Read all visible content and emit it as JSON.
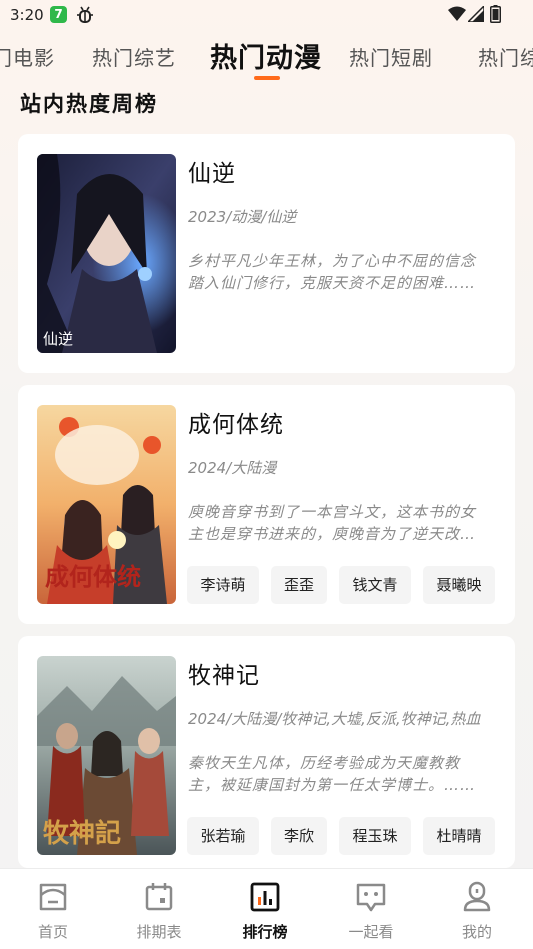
{
  "status_bar": {
    "time": "3:20",
    "app_badge": "7"
  },
  "tabs": [
    {
      "label": "门电影"
    },
    {
      "label": "热门综艺"
    },
    {
      "label": "热门动漫",
      "active": true
    },
    {
      "label": "热门短剧"
    },
    {
      "label": "热门综"
    }
  ],
  "section_title": "站内热度周榜",
  "items": [
    {
      "title": "仙逆",
      "meta": "2023/动漫/仙逆",
      "desc": "乡村平凡少年王林，为了心中不屈的信念踏入仙门修行，克服天资不足的困难……",
      "poster_text": "仙逆",
      "tags": []
    },
    {
      "title": "成何体统",
      "meta": "2024/大陆漫",
      "desc": "庾晚音穿书到了一本宫斗文，这本书的女主也是穿书进来的，庾晚音为了逆天改命……",
      "poster_text": "成何体统",
      "tags": [
        "李诗萌",
        "歪歪",
        "钱文青",
        "聂曦映"
      ]
    },
    {
      "title": "牧神记",
      "meta": "2024/大陆漫/牧神记,大墟,反派,牧神记,热血",
      "desc": "秦牧天生凡体，历经考验成为天魔教教主，被延康国封为第一任太学博士。……",
      "poster_text": "牧神記",
      "tags": [
        "张若瑜",
        "李欣",
        "程玉珠",
        "杜晴晴"
      ]
    }
  ],
  "bottom_nav": [
    {
      "label": "首页",
      "icon": "home-icon"
    },
    {
      "label": "排期表",
      "icon": "calendar-icon"
    },
    {
      "label": "排行榜",
      "icon": "ranking-icon",
      "active": true
    },
    {
      "label": "一起看",
      "icon": "chat-icon"
    },
    {
      "label": "我的",
      "icon": "profile-icon"
    }
  ],
  "colors": {
    "accent": "#ff6a1a",
    "active_text": "#111111",
    "muted": "#8a8a8a"
  }
}
